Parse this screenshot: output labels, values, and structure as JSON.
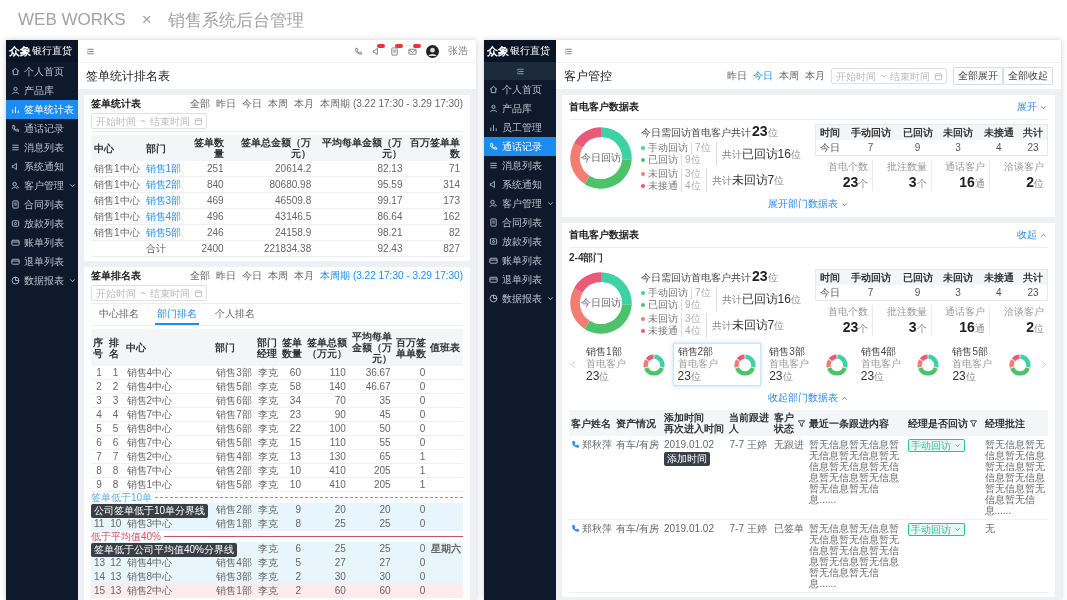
{
  "header": {
    "brand": "WEB WORKS",
    "separator": "×",
    "title": "销售系统后台管理"
  },
  "left": {
    "sidebar": {
      "logo": "众象",
      "logo_sub": "银行直贷",
      "collapse_button": false,
      "items": [
        {
          "label": "个人首页",
          "selected": false,
          "expandable": false
        },
        {
          "label": "产品库",
          "selected": false,
          "expandable": false
        },
        {
          "label": "签单统计表",
          "selected": true,
          "expandable": false
        },
        {
          "label": "通话记录",
          "selected": false,
          "expandable": false
        },
        {
          "label": "消息列表",
          "selected": false,
          "expandable": false
        },
        {
          "label": "系统通知",
          "selected": false,
          "expandable": false
        },
        {
          "label": "客户管理",
          "selected": false,
          "expandable": true
        },
        {
          "label": "合同列表",
          "selected": false,
          "expandable": false
        },
        {
          "label": "放款列表",
          "selected": false,
          "expandable": false
        },
        {
          "label": "账单列表",
          "selected": false,
          "expandable": false
        },
        {
          "label": "退单列表",
          "selected": false,
          "expandable": false
        },
        {
          "label": "数据报表",
          "selected": false,
          "expandable": true
        }
      ]
    },
    "topbar": {
      "user": "张浩"
    },
    "page_title": "签单统计排名表",
    "stats_card": {
      "title": "签单统计表",
      "filters": [
        {
          "label": "全部",
          "selected": false
        },
        {
          "label": "昨日",
          "selected": false
        },
        {
          "label": "今日",
          "selected": false
        },
        {
          "label": "本周",
          "selected": false
        },
        {
          "label": "本月",
          "selected": false
        },
        {
          "label": "本周期 (3.22 17:30 - 3.29 17:30)",
          "selected": false
        }
      ],
      "date_field": {
        "start_placeholder": "开始时间",
        "separator": "~",
        "end_placeholder": "结束时间"
      },
      "columns": [
        "中心",
        "部门",
        "签单数量",
        "签单总金额（万元）",
        "平均每单金额（万元）",
        "百万签单单数"
      ],
      "rows": [
        {
          "center": "销售1中心",
          "dept": "销售1部",
          "count": "251",
          "amount": "20614.2",
          "avg": "82.13",
          "million": "71"
        },
        {
          "center": "销售1中心",
          "dept": "销售2部",
          "count": "840",
          "amount": "80680.98",
          "avg": "95.59",
          "million": "314"
        },
        {
          "center": "销售1中心",
          "dept": "销售3部",
          "count": "469",
          "amount": "46509.8",
          "avg": "99.17",
          "million": "173"
        },
        {
          "center": "销售1中心",
          "dept": "销售4部",
          "count": "496",
          "amount": "43146.5",
          "avg": "86.64",
          "million": "162"
        },
        {
          "center": "销售1中心",
          "dept": "销售5部",
          "count": "246",
          "amount": "24158.9",
          "avg": "98.21",
          "million": "82"
        }
      ],
      "total": {
        "label": "合计",
        "count": "2400",
        "amount": "221834.38",
        "avg": "92.43",
        "million": "827"
      }
    },
    "ranking_card": {
      "title": "签单排名表",
      "filters": [
        {
          "label": "全部",
          "selected": false
        },
        {
          "label": "昨日",
          "selected": false
        },
        {
          "label": "今日",
          "selected": false
        },
        {
          "label": "本周",
          "selected": false
        },
        {
          "label": "本月",
          "selected": false
        },
        {
          "label": "本周期 (3.22 17:30 - 3.29 17:30)",
          "selected": true
        }
      ],
      "date_field": {
        "start_placeholder": "开始时间",
        "separator": "~",
        "end_placeholder": "结束时间"
      },
      "tabs": [
        {
          "label": "中心排名",
          "selected": false
        },
        {
          "label": "部门排名",
          "selected": true
        },
        {
          "label": "个人排名",
          "selected": false
        }
      ],
      "columns": [
        "序号",
        "排名",
        "中心",
        "部门",
        "部门经理",
        "签单数量",
        "签单总额（万元）",
        "平均每单金额（万元）",
        "百万签单单数",
        "值班表"
      ],
      "rows": [
        {
          "kind": "normal",
          "no": "1",
          "rank": "1",
          "center": "销售4中心",
          "dept": "销售3部",
          "manager": "李克",
          "count": "60",
          "amount": "110",
          "avg": "36.67",
          "million": "0"
        },
        {
          "kind": "normal",
          "no": "2",
          "rank": "2",
          "center": "销售4中心",
          "dept": "销售5部",
          "manager": "李克",
          "count": "58",
          "amount": "140",
          "avg": "46.67",
          "million": "0"
        },
        {
          "kind": "normal",
          "no": "3",
          "rank": "3",
          "center": "销售2中心",
          "dept": "销售6部",
          "manager": "李克",
          "count": "34",
          "amount": "70",
          "avg": "35",
          "million": "0"
        },
        {
          "kind": "normal",
          "no": "4",
          "rank": "4",
          "center": "销售7中心",
          "dept": "销售7部",
          "manager": "李克",
          "count": "23",
          "amount": "90",
          "avg": "45",
          "million": "0"
        },
        {
          "kind": "normal",
          "no": "5",
          "rank": "5",
          "center": "销售8中心",
          "dept": "销售6部",
          "manager": "李克",
          "count": "22",
          "amount": "100",
          "avg": "50",
          "million": "0"
        },
        {
          "kind": "normal",
          "no": "6",
          "rank": "6",
          "center": "销售7中心",
          "dept": "销售5部",
          "manager": "李克",
          "count": "15",
          "amount": "110",
          "avg": "55",
          "million": "0"
        },
        {
          "kind": "normal",
          "no": "7",
          "rank": "7",
          "center": "销售2中心",
          "dept": "销售4部",
          "manager": "李克",
          "count": "13",
          "amount": "130",
          "avg": "65",
          "million": "1"
        },
        {
          "kind": "normal",
          "no": "8",
          "rank": "8",
          "center": "销售7中心",
          "dept": "销售2部",
          "manager": "李克",
          "count": "10",
          "amount": "410",
          "avg": "205",
          "million": "1"
        },
        {
          "kind": "normal",
          "no": "9",
          "rank": "8",
          "center": "销售1中心",
          "dept": "销售5部",
          "manager": "李克",
          "count": "10",
          "amount": "410",
          "avg": "205",
          "million": "1"
        },
        {
          "kind": "divider",
          "label": "签单低于10单",
          "tooltip": "公司签单低于10单分界线",
          "dashed": true,
          "color": "#5aaee0"
        },
        {
          "kind": "low",
          "dept": "销售2部",
          "manager": "李克",
          "count": "9",
          "amount": "20",
          "avg": "20",
          "million": "0"
        },
        {
          "kind": "low",
          "no": "11",
          "rank": "10",
          "center": "销售3中心",
          "dept": "销售1部",
          "manager": "李克",
          "count": "8",
          "amount": "25",
          "avg": "25",
          "million": "0"
        },
        {
          "kind": "divider",
          "label": "低于平均值40%",
          "tooltip": "签单低于公司平均值40%分界线",
          "dashed": false,
          "color": "#c4506a"
        },
        {
          "kind": "low",
          "manager": "李克",
          "count": "6",
          "amount": "25",
          "avg": "25",
          "million": "0",
          "duty": "星期六"
        },
        {
          "kind": "low",
          "no": "13",
          "rank": "12",
          "center": "销售4中心",
          "dept": "销售4部",
          "manager": "李克",
          "count": "5",
          "amount": "27",
          "avg": "27",
          "million": "0"
        },
        {
          "kind": "low",
          "no": "14",
          "rank": "13",
          "center": "销售8中心",
          "dept": "销售3部",
          "manager": "李克",
          "count": "2",
          "amount": "30",
          "avg": "30",
          "million": "0"
        },
        {
          "kind": "warn",
          "no": "15",
          "rank": "13",
          "center": "销售2中心",
          "dept": "销售1部",
          "manager": "李克",
          "count": "2",
          "amount": "60",
          "avg": "60",
          "million": "0"
        }
      ]
    }
  },
  "right": {
    "sidebar": {
      "logo": "众象",
      "logo_sub": "银行直贷",
      "collapse_button": true,
      "items": [
        {
          "label": "个人首页",
          "selected": false,
          "expandable": false
        },
        {
          "label": "产品库",
          "selected": false,
          "expandable": false
        },
        {
          "label": "员工管理",
          "selected": false,
          "expandable": false
        },
        {
          "label": "通话记录",
          "selected": true,
          "expandable": false
        },
        {
          "label": "消息列表",
          "selected": false,
          "expandable": false
        },
        {
          "label": "系统通知",
          "selected": false,
          "expandable": false
        },
        {
          "label": "客户管理",
          "selected": false,
          "expandable": true
        },
        {
          "label": "合同列表",
          "selected": false,
          "expandable": false
        },
        {
          "label": "放款列表",
          "selected": false,
          "expandable": false
        },
        {
          "label": "账单列表",
          "selected": false,
          "expandable": false
        },
        {
          "label": "退单列表",
          "selected": false,
          "expandable": false
        },
        {
          "label": "数据报表",
          "selected": false,
          "expandable": true
        }
      ]
    },
    "page_title": "客户管控",
    "filters": [
      {
        "label": "昨日",
        "selected": false
      },
      {
        "label": "今日",
        "selected": true
      },
      {
        "label": "本周",
        "selected": false
      },
      {
        "label": "本月",
        "selected": false
      }
    ],
    "date_field": {
      "start_placeholder": "开始时间",
      "separator": "~",
      "end_placeholder": "结束时间"
    },
    "buttons": [
      "全部展开",
      "全部收起"
    ],
    "cards": [
      {
        "title": "首电客户数据表",
        "toggle": {
          "label": "展开",
          "expanded": false
        },
        "summary": {
          "chart_data": {
            "type": "donut",
            "title": "今日回访",
            "categories": [
              "手动回访",
              "已回访",
              "未回访",
              "未接通"
            ],
            "series": [
              {
                "values": [
                  26,
                  33,
                  24,
                  17
                ]
              }
            ]
          },
          "headline": {
            "text": "今日需回访首电客户共计",
            "value": "23",
            "unit": "位"
          },
          "groups": [
            {
              "items": [
                {
                  "count": "7位",
                  "color": "#3dd1a4"
                },
                {
                  "count": "9位",
                  "color": "#4cc36a"
                }
              ],
              "total": {
                "prefix": "共计",
                "value": "已回访16",
                "unit": "位"
              }
            },
            {
              "items": [
                {
                  "count": "3位",
                  "color": "#f27d72"
                },
                {
                  "count": "4位",
                  "color": "#e85a78"
                }
              ],
              "total": {
                "prefix": "共计",
                "value": "未回访7",
                "unit": "位"
              }
            }
          ],
          "stats_table": {
            "columns": [
              "时间",
              "手动回访",
              "已回访",
              "未回访",
              "未接通",
              "共计"
            ],
            "rows": [
              [
                "今日",
                "7",
                "9",
                "3",
                "4",
                "23"
              ]
            ]
          },
          "stats": [
            {
              "label": "首电个数",
              "value": "23",
              "unit": "个"
            },
            {
              "label": "批注数量",
              "value": "3",
              "unit": "个"
            },
            {
              "label": "通话客户",
              "value": "16",
              "unit": "通"
            },
            {
              "label": "洽谈客户",
              "value": "2",
              "unit": "位"
            }
          ]
        },
        "footer_link": {
          "label": "展开部门数据表",
          "expanded": false
        }
      },
      {
        "title": "首电客户数据表",
        "toggle": {
          "label": "收起",
          "expanded": true
        },
        "group_label": "2-4部门",
        "summary": {
          "chart_data": {
            "type": "donut",
            "title": "今日回访",
            "categories": [
              "手动回访",
              "已回访",
              "未回访",
              "未接通"
            ],
            "series": [
              {
                "values": [
                  26,
                  33,
                  24,
                  17
                ]
              }
            ]
          },
          "headline": {
            "text": "今日需回访首电客户共计",
            "value": "23",
            "unit": "位"
          },
          "groups": [
            {
              "items": [
                {
                  "count": "7位",
                  "color": "#3dd1a4"
                },
                {
                  "count": "9位",
                  "color": "#4cc36a"
                }
              ],
              "total": {
                "prefix": "共计",
                "value": "已回访16",
                "unit": "位"
              }
            },
            {
              "items": [
                {
                  "count": "3位",
                  "color": "#f27d72"
                },
                {
                  "count": "4位",
                  "color": "#e85a78"
                }
              ],
              "total": {
                "prefix": "共计",
                "value": "未回访7",
                "unit": "位"
              }
            }
          ],
          "stats_table": {
            "columns": [
              "时间",
              "手动回访",
              "已回访",
              "未回访",
              "未接通",
              "共计"
            ],
            "rows": [
              [
                "今日",
                "7",
                "9",
                "3",
                "4",
                "23"
              ]
            ]
          },
          "stats": [
            {
              "label": "首电个数",
              "value": "23",
              "unit": "个"
            },
            {
              "label": "批注数量",
              "value": "3",
              "unit": "个"
            },
            {
              "label": "通话客户",
              "value": "16",
              "unit": "通"
            },
            {
              "label": "洽谈客户",
              "value": "2",
              "unit": "位"
            }
          ]
        },
        "departments": [
          {
            "name": "销售1部",
            "label": "首电客户",
            "value": "23",
            "unit": "位",
            "selected": false
          },
          {
            "name": "销售2部",
            "label": "首电客户",
            "value": "23",
            "unit": "位",
            "selected": true
          },
          {
            "name": "销售3部",
            "label": "首电客户",
            "value": "23",
            "unit": "位",
            "selected": false
          },
          {
            "name": "销售4部",
            "label": "首电客户",
            "value": "23",
            "unit": "位",
            "selected": false
          },
          {
            "name": "销售5部",
            "label": "首电客户",
            "value": "23",
            "unit": "位",
            "selected": false
          }
        ],
        "footer_link": {
          "label": "收起部门数据表",
          "expanded": true
        },
        "table": {
          "columns": [
            {
              "label": "客户姓名",
              "filter": false
            },
            {
              "label": "资产情况",
              "filter": false
            },
            {
              "label": "添加时间",
              "sub": "再次进入时间",
              "filter": false
            },
            {
              "label": "当前跟进人",
              "filter": false
            },
            {
              "label": "客户状态",
              "filter": true
            },
            {
              "label": "最近一条跟进内容",
              "filter": false
            },
            {
              "label": "经理是否回访",
              "filter": true
            },
            {
              "label": "经理批注",
              "filter": false
            }
          ],
          "rows": [
            {
              "name": "郑秋萍",
              "assets": "有车/有房",
              "added": "2019.01.02",
              "tooltip": "添加时间",
              "follower": "7-7 王婷",
              "status": "无跟进",
              "latest": "暂无信息暂无信息暂无信息暂无信息暂无信息暂无信息暂无信息暂无信息暂无信息暂无信息暂无信息......",
              "callback": {
                "label": "手动回访",
                "color": "#2fbf96"
              },
              "note": "暂无信息暂无信息暂无信息暂无信息暂无信息暂无信息暂无信息暂无信息暂无信息......"
            },
            {
              "name": "郑秋萍",
              "assets": "有车/有房",
              "added": "2019.01.02",
              "follower": "7-7 王婷",
              "status": "已签单",
              "latest": "暂无信息暂无信息暂无信息暂无信息暂无信息暂无信息暂无信息暂无信息暂无信息暂无信息暂无信息......",
              "callback": {
                "label": "手动回访",
                "color": "#2fbf96"
              },
              "note": "无"
            }
          ]
        }
      }
    ]
  }
}
